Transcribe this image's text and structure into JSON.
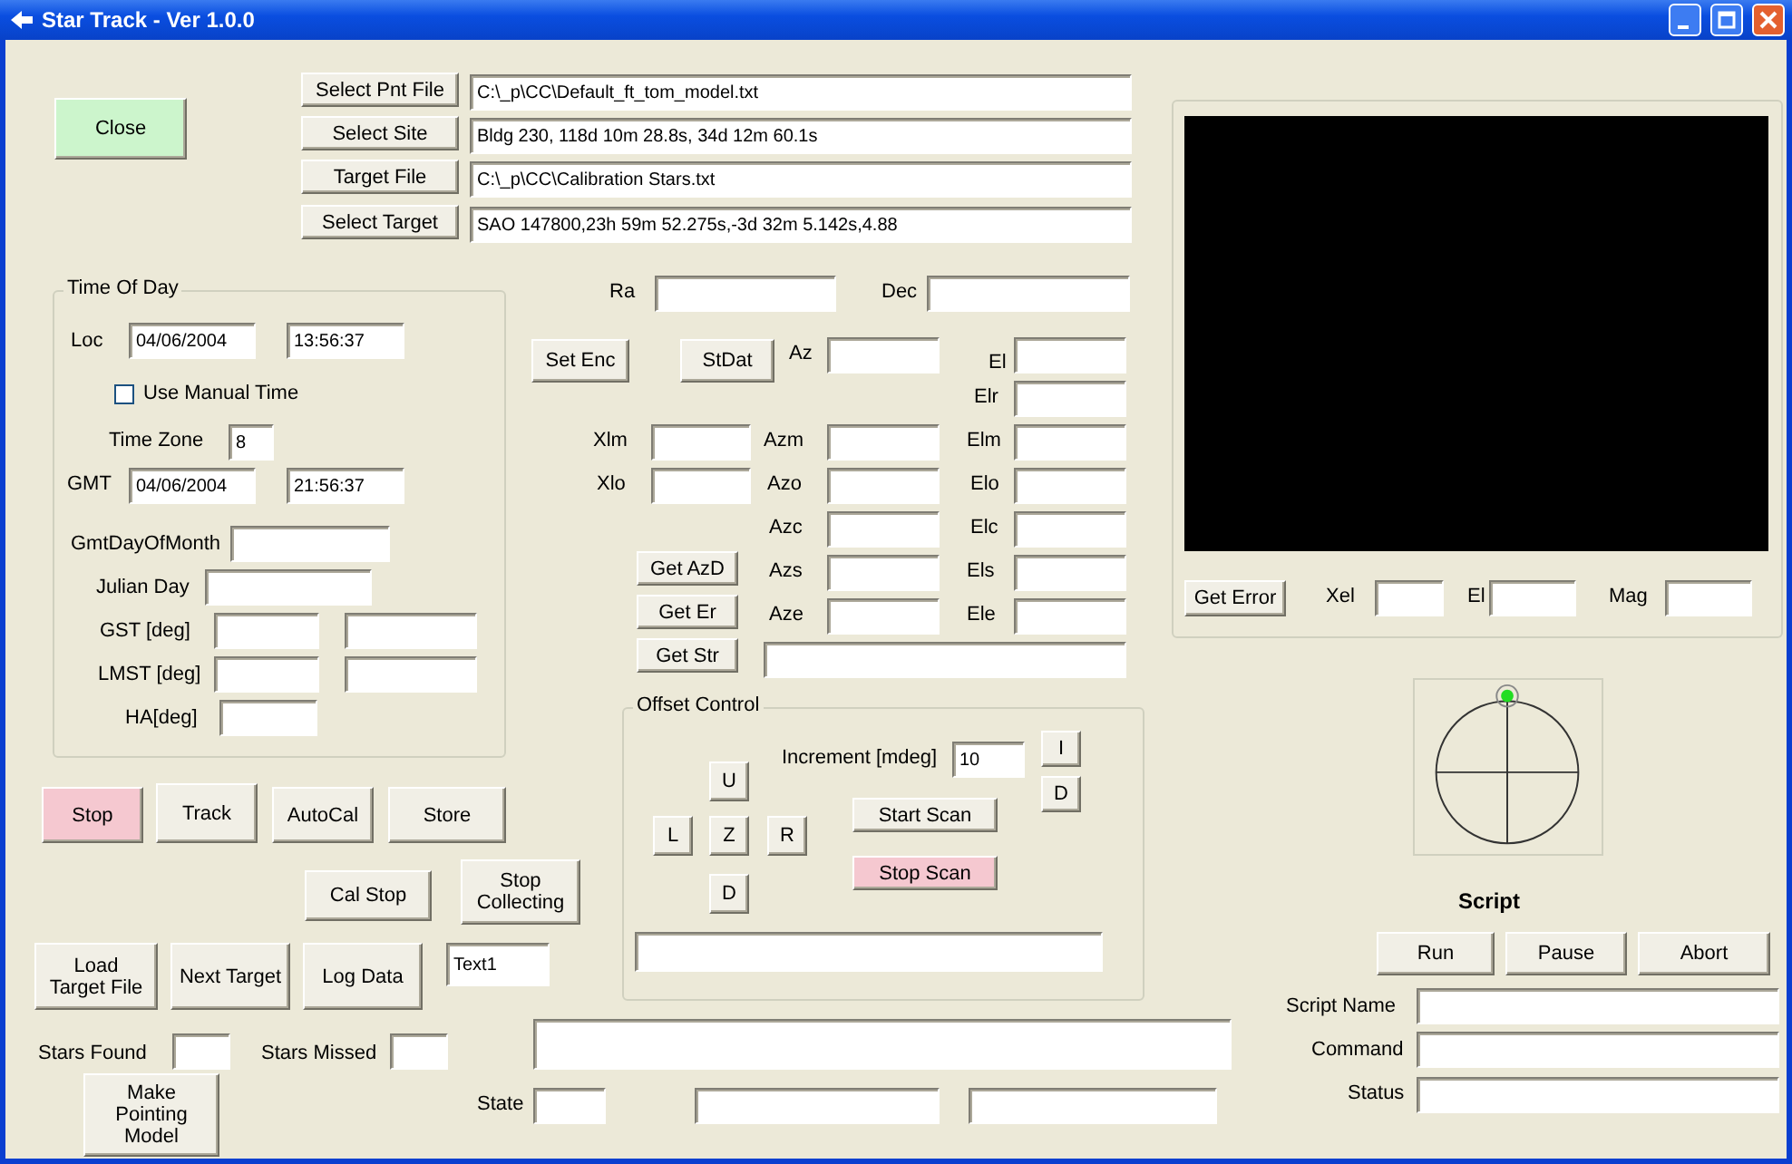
{
  "window": {
    "title": "Star Track - Ver 1.0.0"
  },
  "top": {
    "controls": [
      {
        "kind": "button",
        "text": "Select Pnt File"
      },
      {
        "kind": "field",
        "value": "C:\\_p\\CC\\Default_ft_tom_model.txt"
      },
      {
        "kind": "button",
        "text": "Close",
        "color": "#ccf5cc"
      },
      {
        "kind": "button",
        "text": "Select Site"
      },
      {
        "kind": "field",
        "value": "Bldg 230, 118d 10m 28.8s, 34d 12m 60.1s"
      },
      {
        "kind": "button",
        "text": "Target File"
      },
      {
        "kind": "field",
        "value": "C:\\_p\\CC\\Calibration Stars.txt"
      },
      {
        "kind": "button",
        "text": "Select Target"
      },
      {
        "kind": "field",
        "value": "SAO 147800,23h 59m 52.275s,-3d 32m 5.142s,4.88"
      }
    ]
  },
  "time_of_day": {
    "title": "Time Of Day",
    "controls": [
      {
        "kind": "label",
        "text": "Loc"
      },
      {
        "kind": "field",
        "value": "04/06/2004"
      },
      {
        "kind": "field",
        "value": "13:56:37"
      },
      {
        "kind": "checkbox",
        "text": "Use Manual Time",
        "checked": false
      },
      {
        "kind": "label",
        "text": "Time Zone"
      },
      {
        "kind": "field",
        "value": "8"
      },
      {
        "kind": "label",
        "text": "GMT"
      },
      {
        "kind": "field",
        "value": "04/06/2004"
      },
      {
        "kind": "field",
        "value": "21:56:37"
      },
      {
        "kind": "label",
        "text": "GmtDayOfMonth"
      },
      {
        "kind": "field"
      },
      {
        "kind": "label",
        "text": "Julian Day"
      },
      {
        "kind": "field"
      },
      {
        "kind": "label",
        "text": "GST [deg]"
      },
      {
        "kind": "field"
      },
      {
        "kind": "field"
      },
      {
        "kind": "label",
        "text": "LMST [deg]"
      },
      {
        "kind": "field"
      },
      {
        "kind": "field"
      },
      {
        "kind": "label",
        "text": "HA[deg]"
      },
      {
        "kind": "field"
      }
    ]
  },
  "coordinates": {
    "controls": [
      {
        "kind": "label",
        "text": "Ra"
      },
      {
        "kind": "field"
      },
      {
        "kind": "label",
        "text": "Dec"
      },
      {
        "kind": "field"
      },
      {
        "kind": "button",
        "text": "Set Enc"
      },
      {
        "kind": "button",
        "text": "StDat"
      },
      {
        "kind": "label",
        "text": "Az"
      },
      {
        "kind": "field"
      },
      {
        "kind": "label",
        "text": "El"
      },
      {
        "kind": "field"
      },
      {
        "kind": "label",
        "text": "Elr"
      },
      {
        "kind": "field"
      },
      {
        "kind": "label",
        "text": "Xlm"
      },
      {
        "kind": "field"
      },
      {
        "kind": "label",
        "text": "Azm"
      },
      {
        "kind": "field"
      },
      {
        "kind": "label",
        "text": "Elm"
      },
      {
        "kind": "field"
      },
      {
        "kind": "label",
        "text": "Xlo"
      },
      {
        "kind": "field"
      },
      {
        "kind": "label",
        "text": "Azo"
      },
      {
        "kind": "field"
      },
      {
        "kind": "label",
        "text": "Elo"
      },
      {
        "kind": "field"
      },
      {
        "kind": "label",
        "text": "Azc"
      },
      {
        "kind": "field"
      },
      {
        "kind": "label",
        "text": "Elc"
      },
      {
        "kind": "field"
      },
      {
        "kind": "button",
        "text": "Get AzD"
      },
      {
        "kind": "label",
        "text": "Azs"
      },
      {
        "kind": "field"
      },
      {
        "kind": "label",
        "text": "Els"
      },
      {
        "kind": "field"
      },
      {
        "kind": "button",
        "text": "Get Er"
      },
      {
        "kind": "label",
        "text": "Aze"
      },
      {
        "kind": "field"
      },
      {
        "kind": "label",
        "text": "Ele"
      },
      {
        "kind": "field"
      },
      {
        "kind": "button",
        "text": "Get Str"
      },
      {
        "kind": "field"
      }
    ]
  },
  "offset_control": {
    "title": "Offset Control",
    "controls": [
      {
        "kind": "button",
        "text": "U"
      },
      {
        "kind": "button",
        "text": "L"
      },
      {
        "kind": "button",
        "text": "Z"
      },
      {
        "kind": "button",
        "text": "R"
      },
      {
        "kind": "button",
        "text": "D"
      },
      {
        "kind": "label",
        "text": "Increment [mdeg]"
      },
      {
        "kind": "field",
        "value": "10"
      },
      {
        "kind": "button",
        "text": "I"
      },
      {
        "kind": "button",
        "text": "D"
      },
      {
        "kind": "button",
        "text": "Start Scan"
      },
      {
        "kind": "button",
        "text": "Stop Scan",
        "color": "#f5c8d0"
      },
      {
        "kind": "field"
      }
    ]
  },
  "actions": {
    "controls": [
      {
        "kind": "button",
        "text": "Stop",
        "color": "#f5c8d0"
      },
      {
        "kind": "button",
        "text": "Track"
      },
      {
        "kind": "button",
        "text": "AutoCal"
      },
      {
        "kind": "button",
        "text": "Store"
      },
      {
        "kind": "button",
        "text": "Cal Stop"
      },
      {
        "kind": "button",
        "text": "Stop\nCollecting"
      },
      {
        "kind": "button",
        "text": "Load\nTarget File"
      },
      {
        "kind": "button",
        "text": "Next Target"
      },
      {
        "kind": "button",
        "text": "Log Data"
      },
      {
        "kind": "field",
        "value": "Text1"
      },
      {
        "kind": "label",
        "text": "Stars Found"
      },
      {
        "kind": "field"
      },
      {
        "kind": "label",
        "text": "Stars Missed"
      },
      {
        "kind": "field"
      },
      {
        "kind": "field"
      },
      {
        "kind": "button",
        "text": "Make\nPointing\nModel"
      },
      {
        "kind": "label",
        "text": "State"
      },
      {
        "kind": "field"
      },
      {
        "kind": "field"
      },
      {
        "kind": "field"
      }
    ]
  },
  "camera": {
    "controls": [
      {
        "kind": "video"
      },
      {
        "kind": "button",
        "text": "Get Error"
      },
      {
        "kind": "label",
        "text": "Xel"
      },
      {
        "kind": "field"
      },
      {
        "kind": "label",
        "text": "El"
      },
      {
        "kind": "field"
      },
      {
        "kind": "label",
        "text": "Mag"
      },
      {
        "kind": "field"
      }
    ]
  },
  "script": {
    "controls": [
      {
        "kind": "heading",
        "text": "Script"
      },
      {
        "kind": "button",
        "text": "Run"
      },
      {
        "kind": "button",
        "text": "Pause"
      },
      {
        "kind": "button",
        "text": "Abort"
      },
      {
        "kind": "label",
        "text": "Script Name"
      },
      {
        "kind": "field"
      },
      {
        "kind": "label",
        "text": "Command"
      },
      {
        "kind": "field"
      },
      {
        "kind": "label",
        "text": "Status"
      },
      {
        "kind": "field"
      }
    ]
  }
}
